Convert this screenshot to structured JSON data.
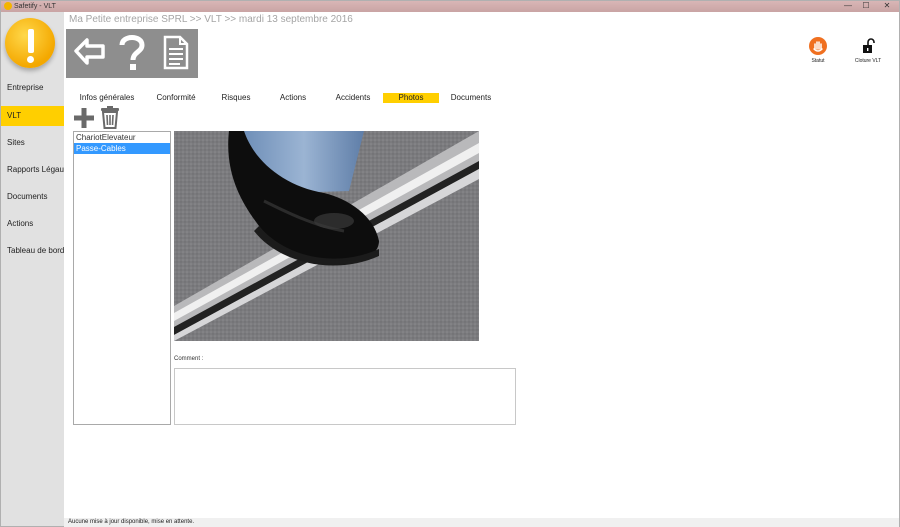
{
  "window": {
    "title": "Safetify - VLT",
    "minimize": "—",
    "maximize": "☐",
    "close": "✕"
  },
  "breadcrumb": "Ma Petite entreprise SPRL >> VLT >> mardi 13 septembre 2016",
  "sidebar": {
    "items": [
      {
        "label": "Entreprise"
      },
      {
        "label": "VLT"
      },
      {
        "label": "Sites"
      },
      {
        "label": "Rapports Légaux"
      },
      {
        "label": "Documents"
      },
      {
        "label": "Actions"
      },
      {
        "label": "Tableau de bord"
      }
    ],
    "active_index": 1
  },
  "toolbar": {
    "icons": [
      "back-arrow-icon",
      "help-question-icon",
      "document-icon"
    ]
  },
  "actions": {
    "statut_label": "Statut",
    "cloture_label": "Cloture VLT"
  },
  "tabs": [
    {
      "label": "Infos générales"
    },
    {
      "label": "Conformité"
    },
    {
      "label": "Risques"
    },
    {
      "label": "Actions"
    },
    {
      "label": "Accidents"
    },
    {
      "label": "Photos"
    },
    {
      "label": "Documents"
    }
  ],
  "active_tab": "Photos",
  "photo_list": {
    "items": [
      {
        "label": "ChariotElevateur",
        "selected": false
      },
      {
        "label": "Passe-Cables",
        "selected": true
      }
    ]
  },
  "comment": {
    "label": "Comment :",
    "value": ""
  },
  "statusbar": {
    "text": "Aucune mise à jour disponible, mise en attente."
  },
  "colors": {
    "accent": "#ffcf00",
    "selection": "#3399ff",
    "toolbar": "#8e8e8e",
    "statut": "#f07020"
  }
}
